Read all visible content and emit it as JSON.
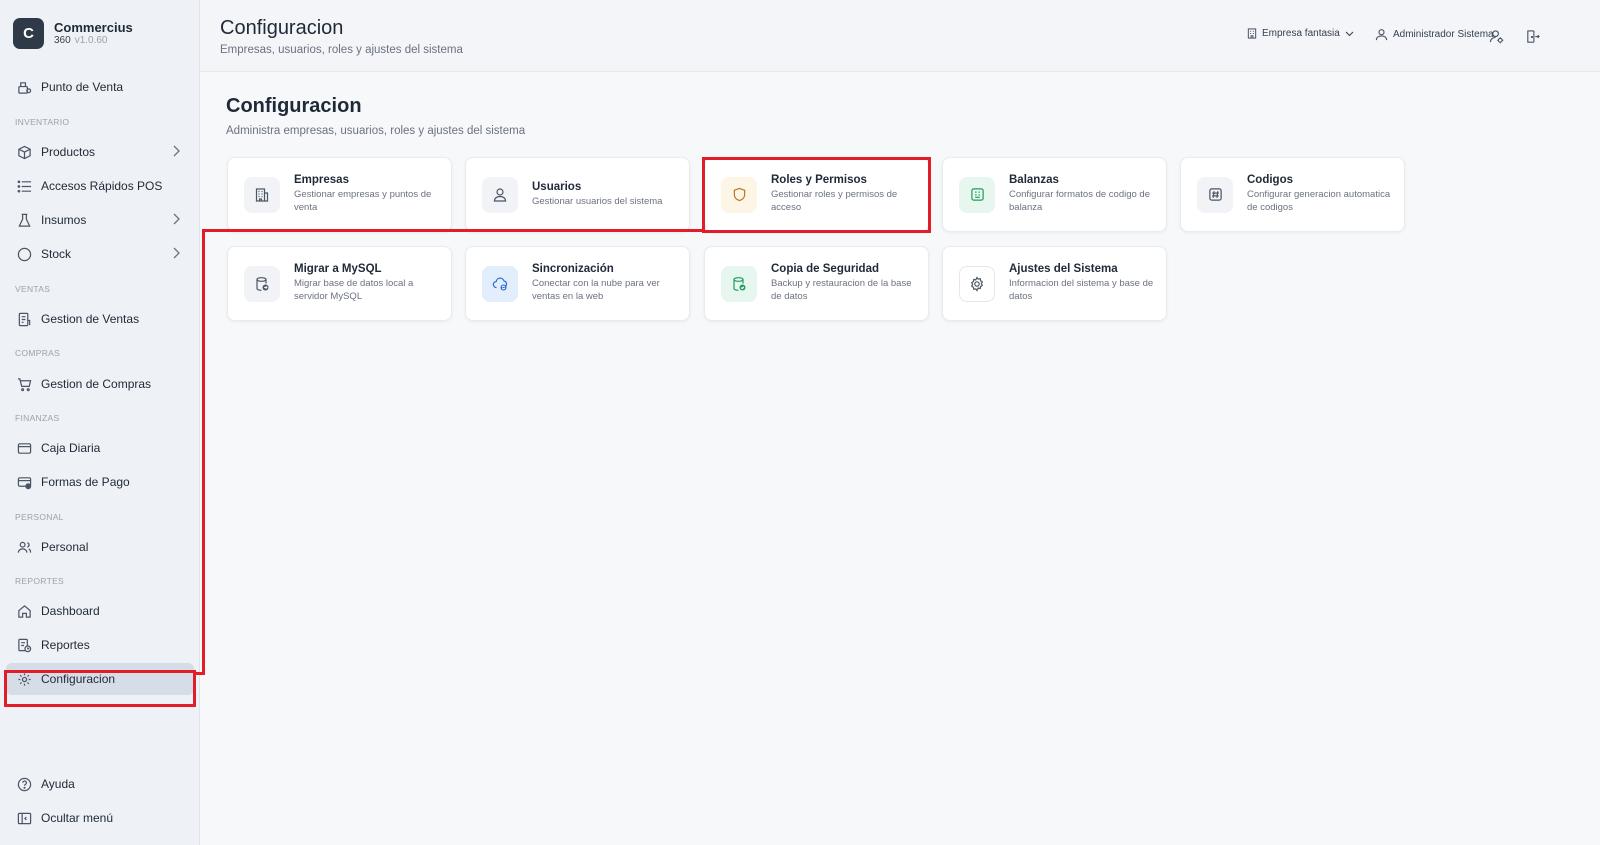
{
  "brand": {
    "logo_letter": "C",
    "name": "Commercius",
    "product": "360",
    "version": "v1.0.60"
  },
  "sidebar": {
    "pos": "Punto de Venta",
    "sections": {
      "inventario": "INVENTARIO",
      "ventas": "VENTAS",
      "compras": "COMPRAS",
      "finanzas": "FINANZAS",
      "personal": "PERSONAL",
      "reportes": "REPORTES"
    },
    "items": {
      "productos": "Productos",
      "accesos": "Accesos Rápidos POS",
      "insumos": "Insumos",
      "stock": "Stock",
      "gestion_ventas": "Gestion de Ventas",
      "gestion_compras": "Gestion de Compras",
      "caja": "Caja Diaria",
      "formas_pago": "Formas de Pago",
      "personal": "Personal",
      "dashboard": "Dashboard",
      "reportes": "Reportes",
      "configuracion": "Configuracion"
    },
    "footer": {
      "ayuda": "Ayuda",
      "ocultar": "Ocultar menú"
    }
  },
  "header": {
    "title": "Configuracion",
    "subtitle": "Empresas, usuarios, roles y ajustes del sistema",
    "company": "Empresa fantasia",
    "user": "Administrador Sistema"
  },
  "main": {
    "title": "Configuracion",
    "subtitle": "Administra empresas, usuarios, roles y ajustes del sistema",
    "cards": [
      {
        "title": "Empresas",
        "desc": "Gestionar empresas y puntos de venta"
      },
      {
        "title": "Usuarios",
        "desc": "Gestionar usuarios del sistema"
      },
      {
        "title": "Roles y Permisos",
        "desc": "Gestionar roles y permisos de acceso"
      },
      {
        "title": "Balanzas",
        "desc": "Configurar formatos de codigo de balanza"
      },
      {
        "title": "Codigos",
        "desc": "Configurar generacion automatica de codigos"
      },
      {
        "title": "Migrar a MySQL",
        "desc": "Migrar base de datos local a servidor MySQL"
      },
      {
        "title": "Sincronización",
        "desc": "Conectar con la nube para ver ventas en la web"
      },
      {
        "title": "Copia de Seguridad",
        "desc": "Backup y restauracion de la base de datos"
      },
      {
        "title": "Ajustes del Sistema",
        "desc": "Informacion del sistema y base de datos"
      }
    ]
  },
  "colors": {
    "highlight": "#e11d2a",
    "accent_dark": "#2f3a48"
  },
  "icons": [
    "building-icon",
    "user-icon",
    "shield-icon",
    "scale-icon",
    "hash-icon",
    "database-migrate-icon",
    "cloud-sync-icon",
    "database-backup-icon",
    "gear-icon"
  ]
}
